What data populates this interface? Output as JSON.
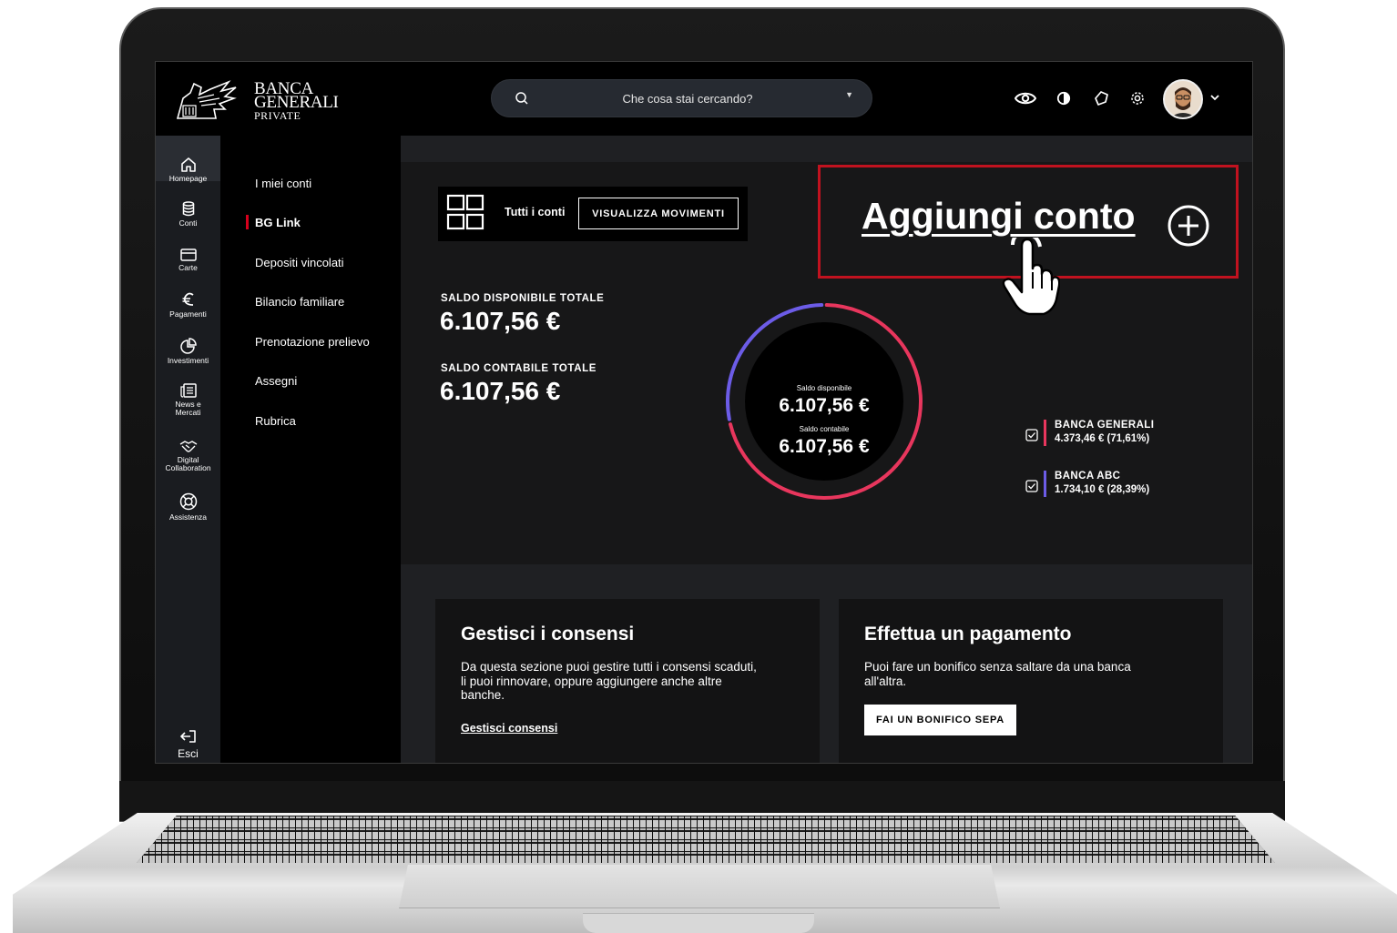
{
  "logo": {
    "line1": "BANCA",
    "line2": "GENERALI",
    "line3": "PRIVATE"
  },
  "search": {
    "placeholder": "Che cosa stai cercando?"
  },
  "toolbar": {
    "icons": [
      "eye-icon",
      "contrast-icon",
      "notification-icon",
      "gear-icon"
    ]
  },
  "rail": {
    "items": [
      {
        "label": "Homepage",
        "icon": "home-icon"
      },
      {
        "label": "Conti",
        "icon": "database-icon"
      },
      {
        "label": "Carte",
        "icon": "card-icon"
      },
      {
        "label": "Pagamenti",
        "icon": "euro-icon"
      },
      {
        "label": "Investimenti",
        "icon": "pie-icon"
      },
      {
        "label": "News e",
        "label2": "Mercati",
        "icon": "news-icon"
      },
      {
        "label": "Digital",
        "label2": "Collaboration",
        "icon": "handshake-icon"
      },
      {
        "label": "Assistenza",
        "icon": "lifebuoy-icon"
      }
    ],
    "exit": "Esci"
  },
  "subnav": {
    "items": [
      "I miei conti",
      "BG Link",
      "Depositi vincolati",
      "Bilancio familiare",
      "Prenotazione prelievo",
      "Assegni",
      "Rubrica"
    ],
    "active": "BG Link"
  },
  "accounts": {
    "label": "Tutti i conti",
    "button": "VISUALIZZA MOVIMENTI"
  },
  "add_account": {
    "label": "Aggiungi conto"
  },
  "balances": {
    "available_label": "SALDO DISPONIBILE TOTALE",
    "available_value": "6.107,56 €",
    "accounting_label": "SALDO CONTABILE TOTALE",
    "accounting_value": "6.107,56 €"
  },
  "donut": {
    "available_label": "Saldo disponibile",
    "available_value": "6.107,56 €",
    "accounting_label": "Saldo contabile",
    "accounting_value": "6.107,56 €",
    "segments": [
      {
        "name": "BANCA GENERALI",
        "share": 71.61,
        "color": "#e8365d"
      },
      {
        "name": "BANCA ABC",
        "share": 28.39,
        "color": "#6c5ce7"
      }
    ]
  },
  "legend": [
    {
      "name": "BANCA GENERALI",
      "value": "4.373,46 € (71,61%)",
      "color": "#e8365d"
    },
    {
      "name": "BANCA ABC",
      "value": "1.734,10 € (28,39%)",
      "color": "#6c5ce7"
    }
  ],
  "cards": {
    "consents": {
      "title": "Gestisci i consensi",
      "text1": "Da questa sezione puoi gestire tutti i consensi scaduti,",
      "text2": "li puoi rinnovare, oppure aggiungere anche altre",
      "text3": "banche.",
      "link": "Gestisci consensi"
    },
    "payment": {
      "title": "Effettua un pagamento",
      "text1": "Puoi fare un bonifico senza saltare da una banca",
      "text2": "all'altra.",
      "button": "FAI UN BONIFICO SEPA"
    }
  }
}
